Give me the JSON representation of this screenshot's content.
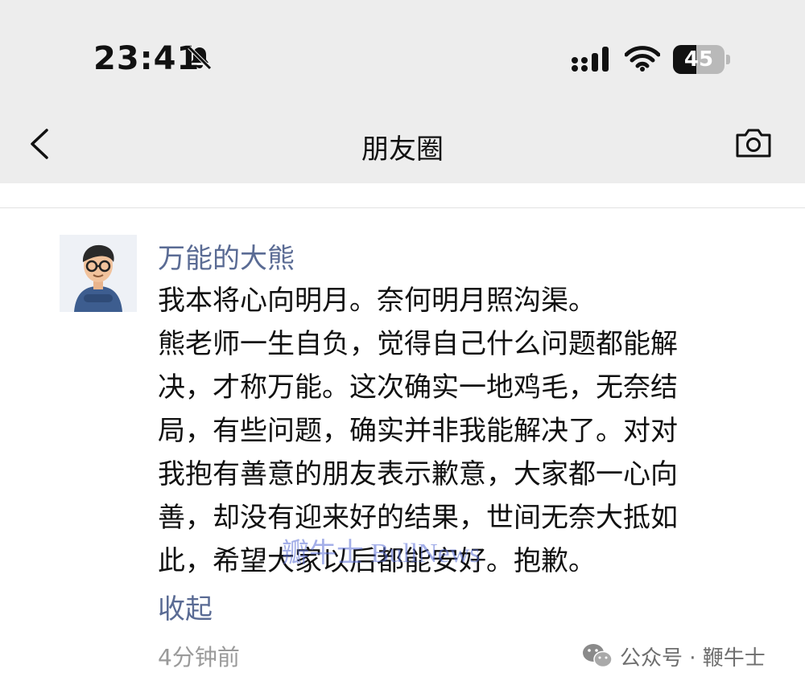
{
  "status_bar": {
    "time": "23:41",
    "battery": "45",
    "battery_level": 0.45,
    "icons": [
      "bell-muted-icon",
      "cellular-signal-icon",
      "wifi-icon",
      "battery-icon"
    ]
  },
  "nav": {
    "title": "朋友圈",
    "back_icon": "chevron-left-icon",
    "camera_icon": "camera-icon"
  },
  "post": {
    "author": "万能的大熊",
    "lines": [
      "我本将心向明月。奈何明月照沟渠。",
      "熊老师一生自负，觉得自己什么问题都能解",
      "决，才称万能。这次确实一地鸡毛，无奈结",
      "局，有些问题，确实并非我能解决了。对对",
      "我抱有善意的朋友表示歉意，大家都一心向",
      "善，却没有迎来好的结果，世间无奈大抵如",
      "此，希望大家以后都能安好。抱歉。"
    ],
    "collapse": "收起",
    "time_ago": "4分钟前"
  },
  "watermark": "瓣牛士 BullNews",
  "source": {
    "label": "公众号 · 鞭牛士",
    "icon": "wechat-icon"
  },
  "colors": {
    "top_bg": "#ededed",
    "link": "#5a6b94",
    "muted": "#9a9a9a"
  }
}
